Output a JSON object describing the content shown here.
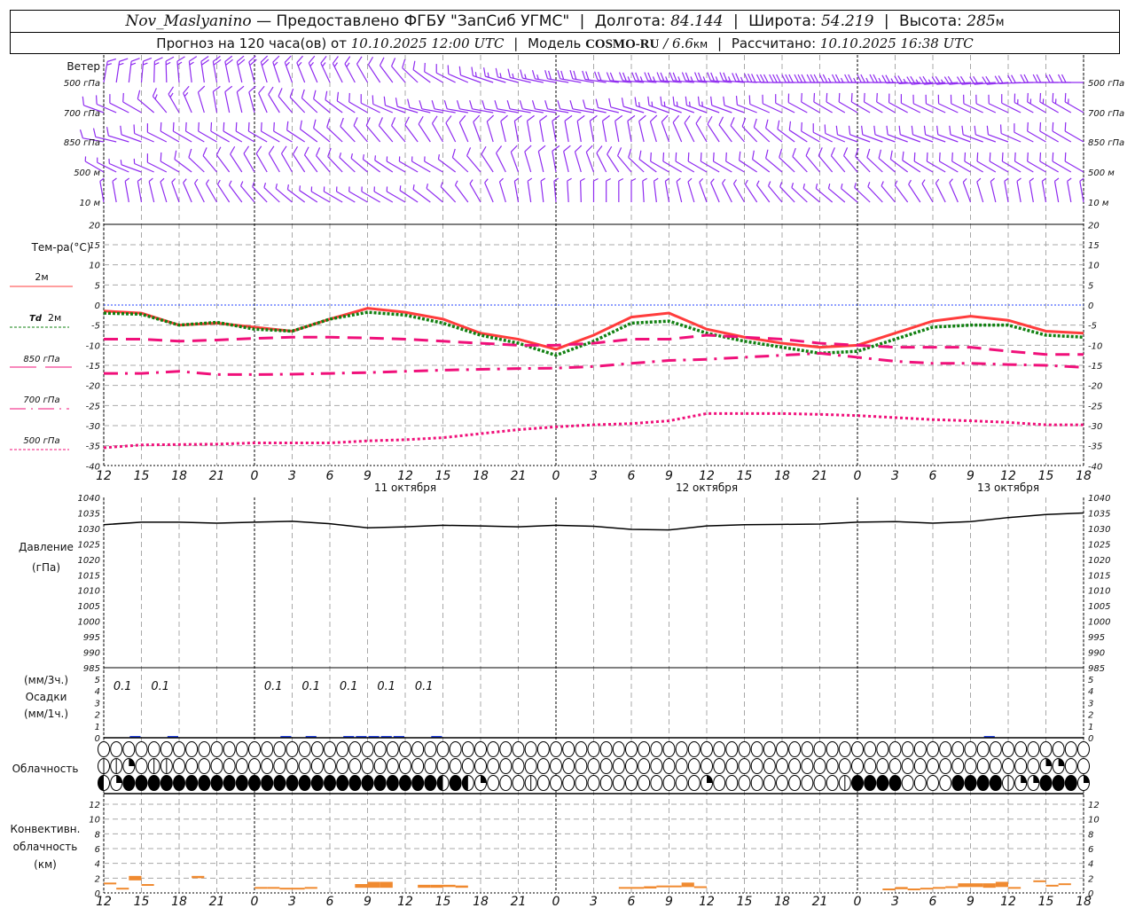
{
  "header": {
    "station": "Nov_Maslyanino",
    "provided": "— Предоставлено ФГБУ \"ЗапСиб УГМС\"",
    "lon_label": "Долгота:",
    "lon": "84.144",
    "lat_label": "Широта:",
    "lat": "54.219",
    "alt_label": "Высота:",
    "alt": "285",
    "alt_unit": "м",
    "forecast_label": "Прогноз на 120 часа(ов) от",
    "forecast_start": "10.10.2025 12:00 UTC",
    "model_label": "Модель",
    "model": "COSMO-RU",
    "resolution": "/ 6.6",
    "res_unit": "км",
    "computed_label": "Рассчитано:",
    "computed": "10.10.2025 16:38 UTC"
  },
  "labels": {
    "wind": "Ветер",
    "wind_levels": [
      "500 гПа",
      "700 гПа",
      "850 гПа",
      "500 м",
      "10   м"
    ],
    "temp_title": "Тем-ра(°C)",
    "t2m": "2м",
    "td": "Td",
    "td2m": "2м",
    "t850": "850 гПа",
    "t700": "700 гПа",
    "t500": "500 гПа",
    "pressure": "Давление",
    "pressure_unit": "(гПа)",
    "precip_3h": "(мм/3ч.)",
    "precip": "Осадки",
    "precip_1h": "(мм/1ч.)",
    "cloud": "Облачность",
    "conv1": "Конвективн.",
    "conv2": "облачность",
    "conv3": "(км)"
  },
  "colors": {
    "wind": "#8f2bf0",
    "t2m": "#ff3c3c",
    "td": "#118011",
    "upper": "#f0107a",
    "zero_line": "#2040ff",
    "precip": "#2040e0",
    "convective": "#f08a30",
    "grid": "#a8a8a8"
  },
  "chart_data": {
    "type": "line",
    "x_ticks": [
      "12",
      "15",
      "18",
      "21",
      "0",
      "3",
      "6",
      "9",
      "12",
      "15",
      "18",
      "21",
      "0",
      "3",
      "6",
      "9",
      "12",
      "15",
      "18",
      "21",
      "0",
      "3",
      "6",
      "9",
      "12",
      "15",
      "18"
    ],
    "dates": [
      {
        "label": "11 октября",
        "tick": 8
      },
      {
        "label": "12 октября",
        "tick": 16
      },
      {
        "label": "13 октября",
        "tick": 24
      }
    ],
    "temperature": {
      "ylim": [
        -40,
        20
      ],
      "yticks": [
        20,
        15,
        10,
        5,
        0,
        -5,
        -10,
        -15,
        -20,
        -25,
        -30,
        -35,
        -40
      ],
      "series": [
        {
          "key": "t2m",
          "values": [
            -1.5,
            -2,
            -5,
            -4.5,
            -5.5,
            -6.5,
            -3.5,
            -0.8,
            -1.8,
            -3.5,
            -7,
            -8.5,
            -11,
            -7.5,
            -3,
            -2,
            -6,
            -8,
            -9.5,
            -10.5,
            -10,
            -7,
            -4,
            -2.8,
            -3.8,
            -6.5,
            -7
          ]
        },
        {
          "key": "td2m",
          "values": [
            -2,
            -2.3,
            -5,
            -4.3,
            -6,
            -6.5,
            -3.5,
            -1.8,
            -2.5,
            -4.5,
            -7.5,
            -9.5,
            -12.5,
            -9,
            -4.5,
            -4,
            -7,
            -9,
            -10.5,
            -12,
            -11.5,
            -8.5,
            -5.5,
            -5,
            -5,
            -7.5,
            -8
          ]
        },
        {
          "key": "t850",
          "values": [
            -8.5,
            -8.5,
            -9,
            -8.7,
            -8.3,
            -8,
            -8,
            -8.2,
            -8.5,
            -9,
            -9.5,
            -10,
            -10,
            -9.5,
            -8.5,
            -8.5,
            -7.5,
            -8,
            -8.5,
            -9.5,
            -10,
            -10.5,
            -10.5,
            -10.5,
            -11.5,
            -12.3,
            -12.3
          ]
        },
        {
          "key": "t700",
          "values": [
            -17,
            -17,
            -16.5,
            -17.3,
            -17.3,
            -17.2,
            -17,
            -16.8,
            -16.5,
            -16.2,
            -16,
            -15.8,
            -15.7,
            -15.3,
            -14.5,
            -13.8,
            -13.5,
            -13,
            -12.5,
            -12,
            -13,
            -14,
            -14.5,
            -14.5,
            -14.8,
            -15,
            -15.5
          ]
        },
        {
          "key": "t500",
          "values": [
            -35.5,
            -34.8,
            -34.7,
            -34.6,
            -34.3,
            -34.3,
            -34.3,
            -33.8,
            -33.5,
            -33,
            -32,
            -31,
            -30.3,
            -29.8,
            -29.5,
            -28.8,
            -27,
            -27,
            -27,
            -27.2,
            -27.5,
            -28,
            -28.5,
            -28.8,
            -29.2,
            -29.8,
            -29.8
          ]
        }
      ]
    },
    "pressure": {
      "ylim": [
        985,
        1040
      ],
      "yticks": [
        1040,
        1035,
        1030,
        1025,
        1020,
        1015,
        1010,
        1005,
        1000,
        995,
        990,
        985
      ],
      "values": [
        1031.2,
        1032,
        1032,
        1031.7,
        1032,
        1032.3,
        1031.5,
        1030.2,
        1030.5,
        1031,
        1030.8,
        1030.5,
        1031,
        1030.7,
        1029.7,
        1029.5,
        1030.8,
        1031.2,
        1031.3,
        1031.4,
        1032,
        1032.2,
        1031.7,
        1032.2,
        1033.5,
        1034.5,
        1035
      ]
    },
    "precipitation": {
      "ylim": [
        0,
        5
      ],
      "yticks": [
        5,
        4,
        3,
        2,
        1,
        0
      ],
      "hourly_mm": [
        0,
        0,
        0.15,
        0,
        0,
        0.05,
        0,
        0,
        0,
        0,
        0,
        0,
        0,
        0,
        0.05,
        0,
        0.05,
        0,
        0,
        0.05,
        0.05,
        0.15,
        0.15,
        0.05,
        0,
        0,
        0.05,
        0,
        0,
        0,
        0,
        0,
        0,
        0,
        0,
        0,
        0,
        0,
        0,
        0,
        0,
        0,
        0,
        0,
        0,
        0,
        0,
        0,
        0,
        0,
        0,
        0,
        0,
        0,
        0,
        0,
        0,
        0,
        0,
        0,
        0,
        0,
        0,
        0,
        0,
        0,
        0,
        0,
        0,
        0,
        0.05,
        0,
        0,
        0,
        0,
        0,
        0,
        0
      ],
      "three_hour_labels": [
        {
          "tick": 0,
          "label": "0.1"
        },
        {
          "tick": 1,
          "label": "0.1"
        },
        {
          "tick": 4,
          "label": "0.1"
        },
        {
          "tick": 5,
          "label": "0.1"
        },
        {
          "tick": 6,
          "label": "0.1"
        },
        {
          "tick": 7,
          "label": "0.1"
        },
        {
          "tick": 8,
          "label": "0.1"
        }
      ]
    },
    "cloud_rows_octas": [
      [
        0,
        0,
        0,
        0,
        0,
        0,
        0,
        0,
        0,
        0,
        0,
        0,
        0,
        0,
        0,
        0,
        0,
        0,
        0,
        0,
        0,
        0,
        0,
        0,
        0,
        0,
        0,
        0,
        0,
        0,
        0,
        0,
        0,
        0,
        0,
        0,
        0,
        0,
        0,
        0,
        0,
        0,
        0,
        0,
        0,
        0,
        0,
        0,
        0,
        0,
        0,
        0,
        0,
        0,
        0,
        0,
        0,
        0,
        0,
        0,
        0,
        0,
        0,
        0,
        0,
        0,
        0,
        0,
        0,
        0,
        0,
        0,
        0,
        0,
        0,
        0,
        0,
        0,
        0
      ],
      [
        1,
        1,
        2,
        0,
        1,
        1,
        0,
        0,
        0,
        0,
        0,
        0,
        0,
        0,
        0,
        0,
        0,
        0,
        0,
        0,
        0,
        0,
        0,
        0,
        0,
        0,
        0,
        0,
        0,
        0,
        0,
        0,
        0,
        0,
        0,
        0,
        0,
        0,
        0,
        0,
        0,
        0,
        0,
        0,
        0,
        0,
        0,
        0,
        0,
        0,
        0,
        0,
        0,
        0,
        0,
        0,
        0,
        0,
        0,
        0,
        0,
        0,
        0,
        0,
        0,
        0,
        0,
        0,
        0,
        0,
        0,
        0,
        0,
        0,
        0,
        2,
        2,
        0,
        0
      ],
      [
        4,
        2,
        8,
        8,
        8,
        8,
        8,
        8,
        8,
        8,
        8,
        8,
        8,
        8,
        8,
        8,
        8,
        8,
        8,
        8,
        8,
        8,
        8,
        8,
        8,
        8,
        8,
        4,
        8,
        4,
        2,
        0,
        0,
        0,
        1,
        0,
        0,
        0,
        0,
        0,
        0,
        0,
        0,
        0,
        0,
        0,
        0,
        0,
        2,
        0,
        0,
        0,
        0,
        0,
        0,
        0,
        0,
        0,
        0,
        1,
        8,
        8,
        8,
        8,
        0,
        0,
        0,
        0,
        8,
        8,
        8,
        8,
        1,
        2,
        2,
        8,
        8,
        8,
        2
      ]
    ],
    "convective": {
      "ylim": [
        0,
        13
      ],
      "yticks": [
        12,
        10,
        8,
        6,
        4,
        2,
        0
      ],
      "bars_hour_base_top_km": [
        [
          0,
          1.2,
          1.4
        ],
        [
          1,
          0.6,
          0.7
        ],
        [
          2,
          1.7,
          2.3
        ],
        [
          3,
          1.0,
          1.2
        ],
        [
          7,
          2.0,
          2.3
        ],
        [
          12,
          0.7,
          0.8
        ],
        [
          13,
          0.7,
          0.8
        ],
        [
          14,
          0.6,
          0.7
        ],
        [
          15,
          0.6,
          0.7
        ],
        [
          16,
          0.6,
          0.8
        ],
        [
          20,
          0.7,
          1.2
        ],
        [
          21,
          0.7,
          1.5
        ],
        [
          22,
          0.7,
          1.5
        ],
        [
          25,
          0.7,
          1.1
        ],
        [
          26,
          0.7,
          1.1
        ],
        [
          27,
          0.8,
          1.1
        ],
        [
          28,
          0.7,
          1.0
        ],
        [
          41,
          0.7,
          0.8
        ],
        [
          42,
          0.7,
          0.8
        ],
        [
          43,
          0.6,
          0.9
        ],
        [
          44,
          0.8,
          1.0
        ],
        [
          45,
          0.8,
          1.0
        ],
        [
          46,
          0.8,
          1.4
        ],
        [
          47,
          0.7,
          0.9
        ],
        [
          62,
          0.55,
          0.6
        ],
        [
          63,
          0.5,
          0.8
        ],
        [
          64,
          0.55,
          0.6
        ],
        [
          65,
          0.6,
          0.7
        ],
        [
          66,
          0.6,
          0.8
        ],
        [
          67,
          0.7,
          0.9
        ],
        [
          68,
          0.8,
          1.3
        ],
        [
          69,
          0.8,
          1.3
        ],
        [
          70,
          0.7,
          1.3
        ],
        [
          71,
          0.8,
          1.5
        ],
        [
          72,
          0.6,
          0.8
        ],
        [
          74,
          1.5,
          1.7
        ],
        [
          75,
          0.9,
          1.1
        ],
        [
          76,
          1.1,
          1.3
        ]
      ]
    },
    "wind": {
      "units": "m/s",
      "levels": [
        {
          "dir": [
            10,
            5,
            355,
            350,
            345,
            340,
            335,
            330,
            320,
            300,
            290,
            285,
            280,
            280,
            275,
            275,
            275,
            275,
            270,
            270,
            270,
            270,
            265,
            265,
            265,
            270,
            270
          ],
          "speed": [
            15,
            15,
            17,
            18,
            18,
            17,
            15,
            12,
            10,
            10,
            12,
            15,
            17,
            20,
            22,
            25,
            25,
            27,
            28,
            28,
            27,
            25,
            25,
            22,
            20,
            20,
            22
          ]
        },
        {
          "dir": [
            290,
            300,
            330,
            350,
            345,
            320,
            310,
            300,
            290,
            280,
            280,
            280,
            280,
            280,
            285,
            290,
            290,
            290,
            295,
            300,
            300,
            300,
            295,
            295,
            295,
            300,
            300
          ],
          "speed": [
            10,
            12,
            13,
            12,
            12,
            10,
            8,
            8,
            10,
            10,
            10,
            12,
            12,
            12,
            12,
            13,
            13,
            12,
            12,
            12,
            12,
            12,
            12,
            12,
            12,
            13,
            14
          ]
        },
        {
          "dir": [
            280,
            290,
            300,
            300,
            300,
            300,
            310,
            320,
            320,
            330,
            340,
            350,
            350,
            350,
            350,
            340,
            330,
            320,
            310,
            300,
            290,
            290,
            290,
            290,
            290,
            300,
            300
          ],
          "speed": [
            8,
            9,
            10,
            10,
            11,
            11,
            10,
            9,
            9,
            8,
            8,
            8,
            9,
            9,
            10,
            10,
            10,
            10,
            10,
            11,
            11,
            11,
            10,
            10,
            10,
            11,
            12
          ]
        },
        {
          "dir": [
            300,
            290,
            300,
            320,
            330,
            330,
            320,
            310,
            300,
            300,
            320,
            340,
            350,
            340,
            320,
            300,
            300,
            300,
            310,
            320,
            320,
            310,
            300,
            300,
            300,
            300,
            300
          ],
          "speed": [
            7,
            7,
            8,
            9,
            9,
            9,
            8,
            7,
            7,
            7,
            8,
            8,
            9,
            9,
            9,
            9,
            9,
            9,
            9,
            9,
            8,
            8,
            8,
            8,
            8,
            9,
            9
          ]
        },
        {
          "dir": [
            350,
            350,
            340,
            330,
            320,
            310,
            300,
            300,
            300,
            310,
            330,
            350,
            355,
            0,
            0,
            350,
            340,
            330,
            320,
            310,
            310,
            320,
            330,
            340,
            350,
            350,
            350
          ],
          "speed": [
            4,
            4,
            4,
            4,
            4,
            3,
            3,
            3,
            3,
            3,
            4,
            4,
            4,
            4,
            4,
            4,
            4,
            4,
            4,
            4,
            4,
            4,
            4,
            4,
            4,
            4,
            4
          ]
        }
      ]
    }
  }
}
